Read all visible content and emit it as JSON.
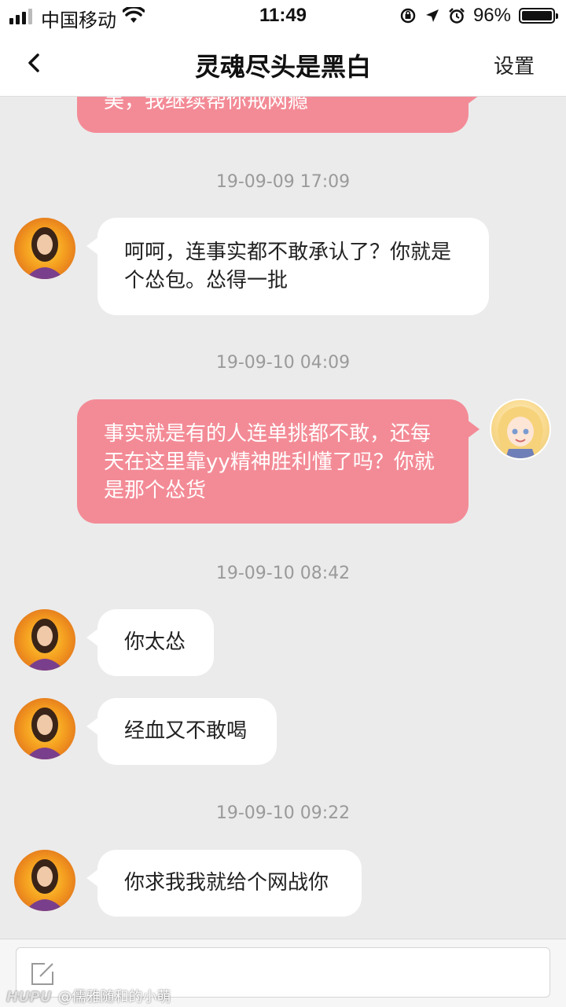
{
  "status_bar": {
    "carrier": "中国移动",
    "time": "11:49",
    "battery": "96%",
    "battery_level": 0.96
  },
  "nav": {
    "title": "灵魂尽头是黑白",
    "settings_label": "设置"
  },
  "messages": [
    {
      "type": "out",
      "text": "美，我继续帮你戒网瘾"
    },
    {
      "type": "time",
      "text": "19-09-09 17:09"
    },
    {
      "type": "in",
      "text": "呵呵，连事实都不敢承认了？你就是个怂包。怂得一批"
    },
    {
      "type": "time",
      "text": "19-09-10 04:09"
    },
    {
      "type": "out",
      "text": "事实就是有的人连单挑都不敢，还每天在这里靠yy精神胜利懂了吗？你就是那个怂货"
    },
    {
      "type": "time",
      "text": "19-09-10 08:42"
    },
    {
      "type": "in",
      "text": "你太怂"
    },
    {
      "type": "in",
      "text": "经血又不敢喝"
    },
    {
      "type": "time",
      "text": "19-09-10 09:22"
    },
    {
      "type": "in",
      "text": "你求我我就给个网战你"
    }
  ],
  "watermark": {
    "brand": "HUPU",
    "user": "@儒雅随和的小萌"
  },
  "colors": {
    "incoming_bubble": "#ffffff",
    "outgoing_bubble": "#f38b96",
    "background": "#ebebeb"
  }
}
